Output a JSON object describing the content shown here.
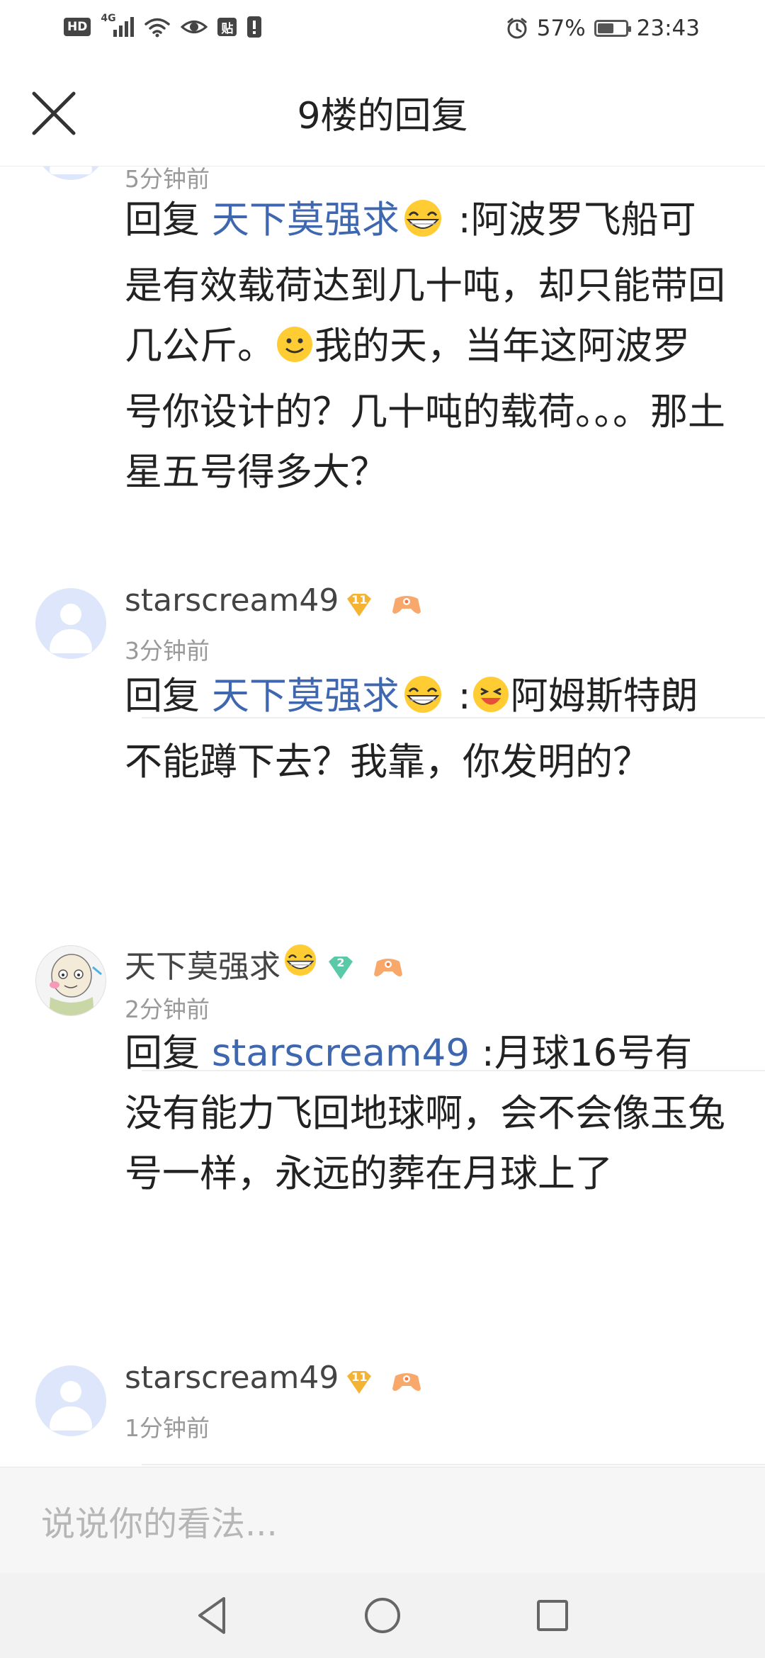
{
  "status_bar": {
    "hd_badge": "HD",
    "network": "4G",
    "post_badge": "贴",
    "battery_percent": "57%",
    "battery_level": 0.57,
    "time": "23:43"
  },
  "header": {
    "title": "9楼的回复",
    "close_icon": "close-icon"
  },
  "replies": [
    {
      "time": "5分钟前",
      "prefix": "回复 ",
      "mention": "天下莫强求",
      "text_a": " :阿波罗飞船可是有效载荷达到几十吨，却只能带回几公斤。",
      "text_b": "我的天，当年这阿波罗号你设计的？几十吨的载荷。。。那土星五号得多大？"
    },
    {
      "username": "starscream49",
      "level": "11",
      "time": "3分钟前",
      "prefix": "回复 ",
      "mention": "天下莫强求",
      "text_a": " :",
      "text_b": "阿姆斯特朗不能蹲下去？我靠，你发明的？"
    },
    {
      "username": "天下莫强求",
      "level": "2",
      "time": "2分钟前",
      "prefix": "回复 ",
      "mention": "starscream49",
      "text_a": " :月球16号有没有能力飞回地球啊，会不会像玉兔号一样，永远的葬在月球上了"
    },
    {
      "username": "starscream49",
      "level": "11",
      "time": "1分钟前"
    }
  ],
  "input": {
    "placeholder": "说说你的看法..."
  },
  "nav": {
    "back": "back-icon",
    "home": "home-icon",
    "recents": "recents-icon"
  },
  "colors": {
    "mention": "#3e67b0",
    "text": "#222222",
    "muted": "#999999",
    "badge_gold": "#f5b333",
    "badge_green": "#5ac9a8"
  }
}
